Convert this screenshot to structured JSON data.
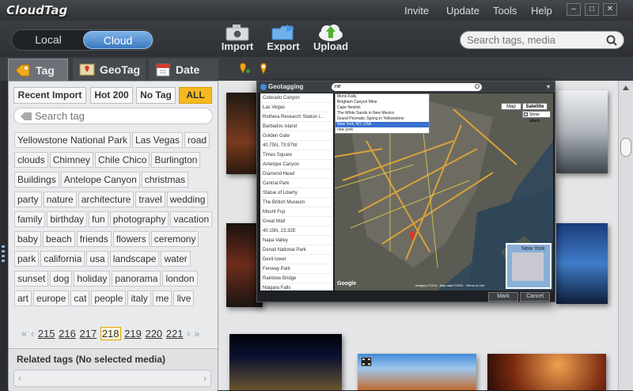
{
  "app": {
    "title": "CloudTag"
  },
  "menu": [
    "Invite",
    "Update",
    "Tools",
    "Help"
  ],
  "toggle": {
    "local": "Local",
    "cloud": "Cloud"
  },
  "toolbar": {
    "import": "Import",
    "export": "Export",
    "upload": "Upload"
  },
  "search": {
    "placeholder": "Search tags, media"
  },
  "tabs": {
    "tag": "Tag",
    "geotag": "GeoTag",
    "date": "Date"
  },
  "filters": [
    "Recent Import",
    "Hot 200",
    "No Tag",
    "ALL"
  ],
  "tag_search": {
    "placeholder": "Search tag"
  },
  "tags": [
    "Yellowstone National Park",
    "Las Vegas",
    "road",
    "clouds",
    "Chimney",
    "Chile Chico",
    "Burlington",
    "Buildings",
    "Antelope Canyon",
    "christmas",
    "party",
    "nature",
    "architecture",
    "travel",
    "wedding",
    "family",
    "birthday",
    "fun",
    "photography",
    "vacation",
    "baby",
    "beach",
    "friends",
    "flowers",
    "ceremony",
    "park",
    "california",
    "usa",
    "landscape",
    "water",
    "sunset",
    "dog",
    "holiday",
    "panorama",
    "london",
    "art",
    "europe",
    "cat",
    "people",
    "italy",
    "me",
    "live"
  ],
  "pager": {
    "pages": [
      "215",
      "216",
      "217",
      "218",
      "219",
      "220",
      "221"
    ],
    "current": "218"
  },
  "related": {
    "title": "Related tags (No selected media)"
  },
  "dialog": {
    "title": "Geotagging",
    "search_value": "ne",
    "locations": [
      "Colorado Canyon",
      "Las Vegas",
      "Rothera Research Station i...",
      "Barbados island",
      "Golden Gate",
      "40.75N, 73.97W",
      "Times Square",
      "Antelope Canyon",
      "Diamond Head",
      "Central Park",
      "Statue of Liberty",
      "The British Museum",
      "Mount Fuji",
      "Great Wall",
      "40.15N, 23.32E",
      "Napa Valley",
      "Denali National Park",
      "Devil tower",
      "Fenway Park",
      "Rainbow Bridge",
      "Niagara Falls",
      "Arches National Park"
    ],
    "suggestions": [
      "Mono Falls",
      "Bingham Canyon Mine",
      "Cape Nestick",
      "The White Sands in New Mexico",
      "Grand Prismatic Spring in Yellowstone",
      "New York, NY, USA",
      "new york"
    ],
    "selected_suggestion": "New York, NY, USA",
    "map_modes": [
      "Map",
      "Satellite"
    ],
    "show_labels": "Show labels",
    "inset_label": "New York",
    "copyright": "Imagery ©2010 , Map data ©2010 - Terms of Use",
    "mark": "Mark",
    "cancel": "Cancel"
  }
}
